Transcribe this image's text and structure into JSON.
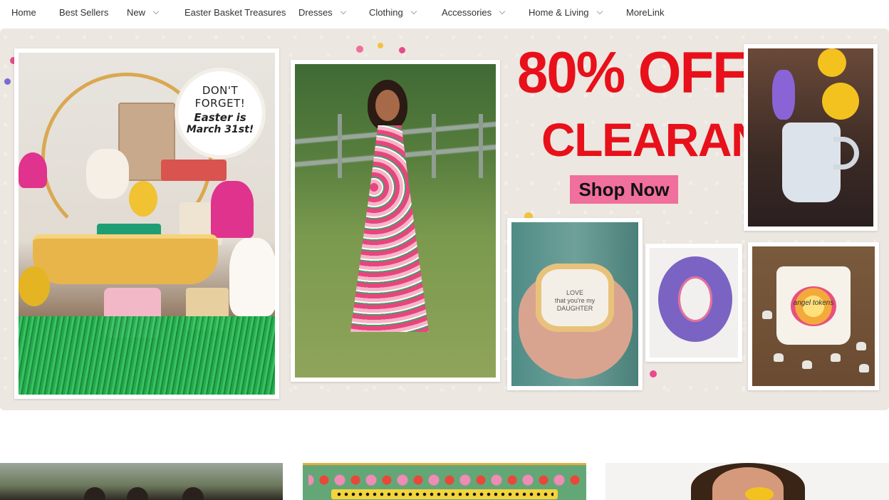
{
  "nav": {
    "items": [
      {
        "label": "Home",
        "dropdown": false
      },
      {
        "label": "Best Sellers",
        "dropdown": false
      },
      {
        "label": "New",
        "dropdown": true
      },
      {
        "label": "Easter Basket Treasures",
        "dropdown": false
      },
      {
        "label": "Dresses",
        "dropdown": true
      },
      {
        "label": "Clothing",
        "dropdown": true
      },
      {
        "label": "Accessories",
        "dropdown": true
      },
      {
        "label": "Home & Living",
        "dropdown": true
      },
      {
        "label": "MoreLink",
        "dropdown": false
      }
    ]
  },
  "hero": {
    "reminder": {
      "line1": "DON'T",
      "line2": "FORGET!",
      "line3": "Easter is",
      "line4": "March 31st!"
    },
    "sale_line1": "80% OFF",
    "sale_line2": "CLEARANCE",
    "cta_label": "Shop Now",
    "dish_text": "LOVE\nthat you're my\nDAUGHTER",
    "pouch_text": "angel tokens",
    "colors": {
      "sale_red": "#e8101a",
      "cta_pink": "#f06f9c",
      "background": "#ece7e0"
    }
  }
}
